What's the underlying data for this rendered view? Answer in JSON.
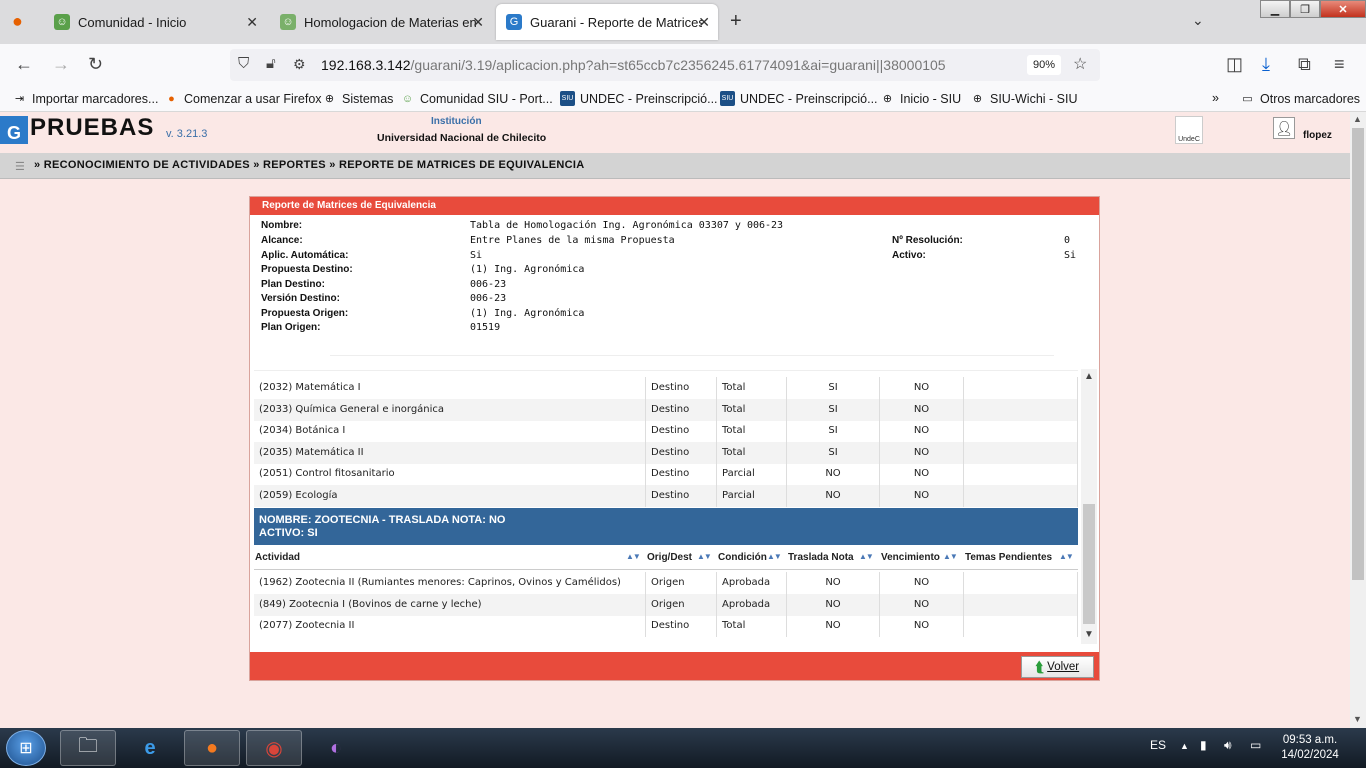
{
  "browser": {
    "tabs": [
      {
        "title": "Comunidad - Inicio",
        "icon": "people-icon"
      },
      {
        "title": "Homologacion de Materias ent",
        "icon": "people-icon"
      },
      {
        "title": "Guarani - Reporte de Matrices d",
        "icon": "guarani-icon"
      }
    ],
    "url_host": "192.168.3.142",
    "url_path": "/guarani/3.19/aplicacion.php?ah=st65ccb7c2356245.61774091&ai=guarani||38000105",
    "zoom": "90%",
    "bookmarks": [
      "Importar marcadores...",
      "Comenzar a usar Firefox",
      "Sistemas",
      "Comunidad SIU - Port...",
      "UNDEC - Preinscripció...",
      "UNDEC - Preinscripció...",
      "Inicio - SIU",
      "SIU-Wichi - SIU"
    ],
    "other_bookmarks": "Otros marcadores"
  },
  "app": {
    "logo_letter": "G",
    "title": "PRUEBAS",
    "version": "v. 3.21.3",
    "institution_label": "Institución",
    "institution_name": "Universidad Nacional de Chilecito",
    "undec_label": "UndeC",
    "user": "flopez"
  },
  "breadcrumb": "» RECONOCIMIENTO DE ACTIVIDADES » REPORTES »  REPORTE DE MATRICES DE EQUIVALENCIA",
  "panel": {
    "title": "Reporte de Matrices de Equivalencia",
    "fields": {
      "nombre_k": "Nombre:",
      "nombre_v": "Tabla de Homologación Ing. Agronómica 03307 y 006-23",
      "alcance_k": "Alcance:",
      "alcance_v": "Entre Planes de la misma Propuesta",
      "aplic_k": "Aplic. Automática:",
      "aplic_v": "Si",
      "prop_dest_k": "Propuesta Destino:",
      "prop_dest_v": "(1) Ing. Agronómica",
      "plan_dest_k": "Plan Destino:",
      "plan_dest_v": "006-23",
      "ver_dest_k": "Versión Destino:",
      "ver_dest_v": "006-23",
      "prop_orig_k": "Propuesta Origen:",
      "prop_orig_v": "(1) Ing. Agronómica",
      "plan_orig_k": "Plan Origen:",
      "plan_orig_v": "01519",
      "resol_k": "Nº Resolución:",
      "resol_v": "0",
      "activo_k": "Activo:",
      "activo_v": "Si"
    },
    "rows_top": [
      {
        "actividad": "(2032) Matemática I",
        "orig": "Destino",
        "cond": "Total",
        "traslada": "SI",
        "venc": "NO",
        "temas": ""
      },
      {
        "actividad": "(2033) Química General e inorgánica",
        "orig": "Destino",
        "cond": "Total",
        "traslada": "SI",
        "venc": "NO",
        "temas": ""
      },
      {
        "actividad": "(2034) Botánica I",
        "orig": "Destino",
        "cond": "Total",
        "traslada": "SI",
        "venc": "NO",
        "temas": ""
      },
      {
        "actividad": "(2035) Matemática II",
        "orig": "Destino",
        "cond": "Total",
        "traslada": "SI",
        "venc": "NO",
        "temas": ""
      },
      {
        "actividad": "(2051) Control fitosanitario",
        "orig": "Destino",
        "cond": "Parcial",
        "traslada": "NO",
        "venc": "NO",
        "temas": ""
      },
      {
        "actividad": "(2059) Ecología",
        "orig": "Destino",
        "cond": "Parcial",
        "traslada": "NO",
        "venc": "NO",
        "temas": ""
      }
    ],
    "group_line1": "NOMBRE: ZOOTECNIA - TRASLADA NOTA: NO",
    "group_line2": "ACTIVO: SI",
    "columns": [
      "Actividad",
      "Orig/Dest",
      "Condición",
      "Traslada Nota",
      "Vencimiento",
      "Temas Pendientes"
    ],
    "rows_bottom": [
      {
        "actividad": "(1962) Zootecnia II (Rumiantes menores: Caprinos, Ovinos y Camélidos)",
        "orig": "Origen",
        "cond": "Aprobada",
        "traslada": "NO",
        "venc": "NO",
        "temas": ""
      },
      {
        "actividad": "(849) Zootecnia I (Bovinos de carne y leche)",
        "orig": "Origen",
        "cond": "Aprobada",
        "traslada": "NO",
        "venc": "NO",
        "temas": ""
      },
      {
        "actividad": "(2077) Zootecnia II",
        "orig": "Destino",
        "cond": "Total",
        "traslada": "NO",
        "venc": "NO",
        "temas": ""
      }
    ],
    "volver": "Volver"
  },
  "taskbar": {
    "lang": "ES",
    "time": "09:53 a.m.",
    "date": "14/02/2024"
  },
  "colors": {
    "accent_red": "#e84b3c",
    "group_blue": "#336699",
    "page_bg": "#fbe8e6"
  }
}
